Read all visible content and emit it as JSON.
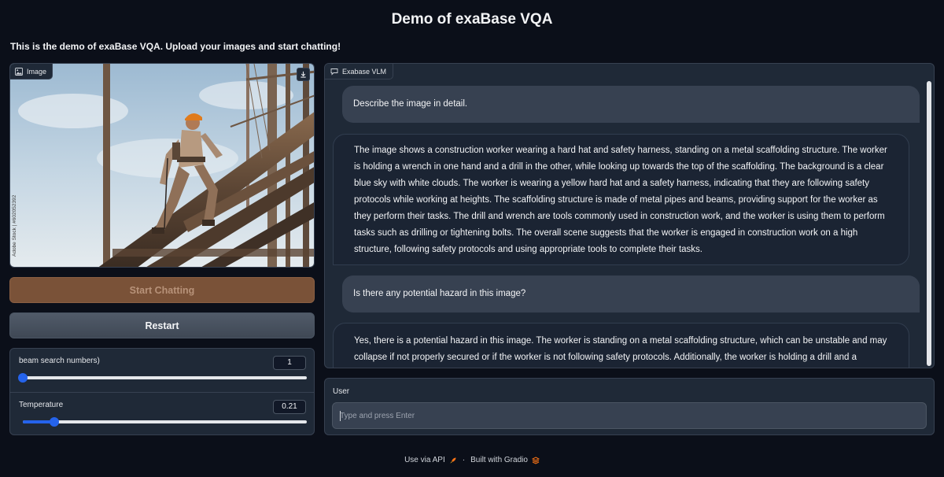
{
  "page": {
    "title": "Demo of exaBase VQA",
    "subtitle": "This is the demo of exaBase VQA. Upload your images and start chatting!"
  },
  "image_panel": {
    "label": "Image",
    "watermark": "Adobe Stock | #602052392"
  },
  "buttons": {
    "start_chatting": "Start Chatting",
    "restart": "Restart"
  },
  "settings": {
    "beam": {
      "label": "beam search numbers)",
      "value": "1",
      "fraction": 0.0
    },
    "temperature": {
      "label": "Temperature",
      "value": "0.21",
      "fraction": 0.11
    }
  },
  "chatbot": {
    "label": "Exabase VLM",
    "messages": [
      {
        "role": "user",
        "text": "Describe the image in detail."
      },
      {
        "role": "bot",
        "text": "The image shows a construction worker wearing a hard hat and safety harness, standing on a metal scaffolding structure. The worker is holding a wrench in one hand and a drill in the other, while looking up towards the top of the scaffolding. The background is a clear blue sky with white clouds. The worker is wearing a yellow hard hat and a safety harness, indicating that they are following safety protocols while working at heights. The scaffolding structure is made of metal pipes and beams, providing support for the worker as they perform their tasks. The drill and wrench are tools commonly used in construction work, and the worker is using them to perform tasks such as drilling or tightening bolts. The overall scene suggests that the worker is engaged in construction work on a high structure, following safety protocols and using appropriate tools to complete their tasks."
      },
      {
        "role": "user",
        "text": "Is there any potential hazard in this image?"
      },
      {
        "role": "bot",
        "text": "Yes, there is a potential hazard in this image. The worker is standing on a metal scaffolding structure, which can be unstable and may collapse if not properly secured or if the worker is not following safety protocols. Additionally, the worker is holding a drill and a"
      }
    ]
  },
  "user_input": {
    "label": "User",
    "placeholder": "Type and press Enter",
    "value": ""
  },
  "footer": {
    "api_link": "Use via API",
    "separator": "·",
    "gradio_link": "Built with Gradio"
  },
  "colors": {
    "background": "#0b0f19",
    "panel": "#1f2937",
    "accent_orange": "#7a5238",
    "slider_blue": "#2563eb"
  },
  "icons": [
    "image-icon",
    "download-icon",
    "chat-icon",
    "rocket-icon",
    "gradio-logo-icon"
  ]
}
